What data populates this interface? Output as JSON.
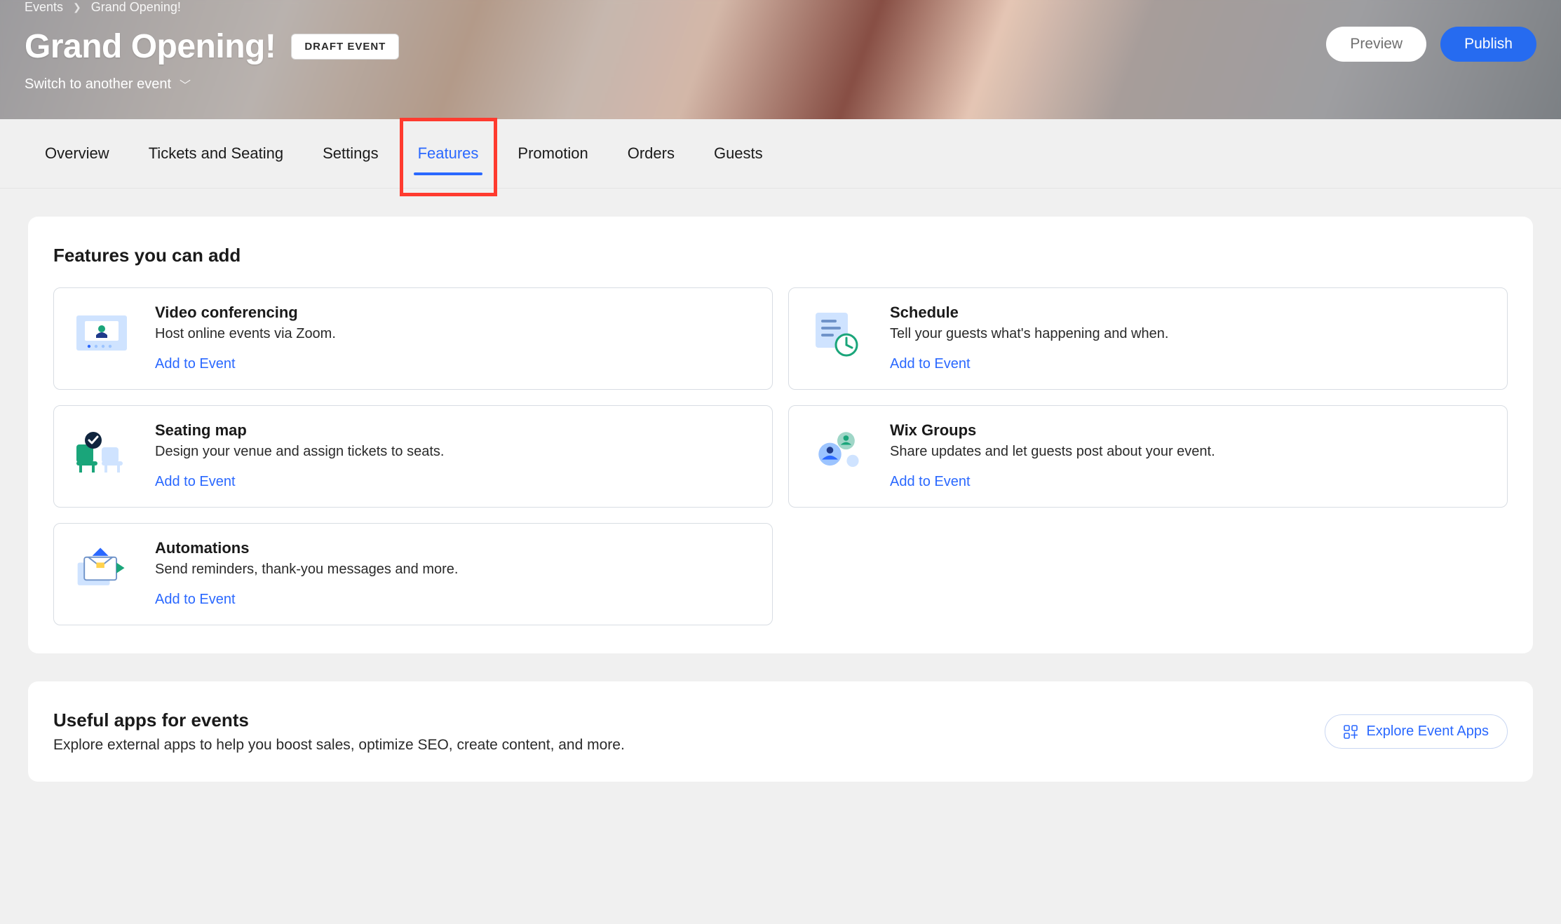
{
  "breadcrumb": {
    "root": "Events",
    "current": "Grand Opening!"
  },
  "header": {
    "title": "Grand Opening!",
    "badge": "DRAFT EVENT",
    "switch_label": "Switch to another event",
    "preview": "Preview",
    "publish": "Publish"
  },
  "tabs": [
    {
      "label": "Overview",
      "active": false
    },
    {
      "label": "Tickets and Seating",
      "active": false
    },
    {
      "label": "Settings",
      "active": false
    },
    {
      "label": "Features",
      "active": true
    },
    {
      "label": "Promotion",
      "active": false
    },
    {
      "label": "Orders",
      "active": false
    },
    {
      "label": "Guests",
      "active": false
    }
  ],
  "features_panel": {
    "title": "Features you can add",
    "cta": "Add to Event",
    "items": [
      {
        "title": "Video conferencing",
        "desc": "Host online events via Zoom."
      },
      {
        "title": "Schedule",
        "desc": "Tell your guests what's happening and when."
      },
      {
        "title": "Seating map",
        "desc": "Design your venue and assign tickets to seats."
      },
      {
        "title": "Wix Groups",
        "desc": "Share updates and let guests post about your event."
      },
      {
        "title": "Automations",
        "desc": "Send reminders, thank-you messages and more."
      }
    ]
  },
  "apps_panel": {
    "title": "Useful apps for events",
    "desc": "Explore external apps to help you boost sales, optimize SEO, create content, and more.",
    "cta": "Explore Event Apps"
  },
  "colors": {
    "accent": "#2a68ff",
    "highlight_box": "#ff3b2f"
  }
}
